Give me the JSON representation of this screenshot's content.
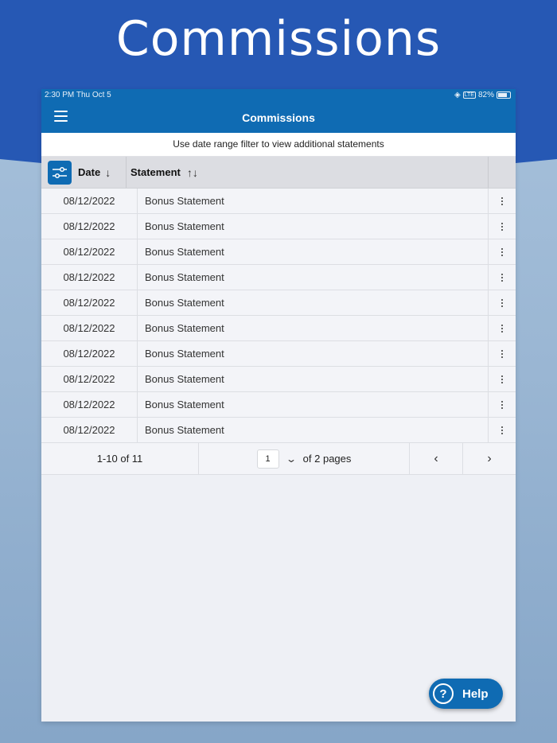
{
  "hero": {
    "title": "Commissions"
  },
  "status_bar": {
    "time": "2:30 PM  Thu Oct 5",
    "network": "LTE",
    "battery": "82%"
  },
  "header": {
    "title": "Commissions"
  },
  "notice": "Use date range filter to view additional statements",
  "grid": {
    "columns": {
      "date": "Date",
      "statement": "Statement"
    },
    "sort_icons": {
      "date": "↓",
      "statement": "↑↓"
    },
    "rows": [
      {
        "date": "08/12/2022",
        "statement": "Bonus Statement"
      },
      {
        "date": "08/12/2022",
        "statement": "Bonus Statement"
      },
      {
        "date": "08/12/2022",
        "statement": "Bonus Statement"
      },
      {
        "date": "08/12/2022",
        "statement": "Bonus Statement"
      },
      {
        "date": "08/12/2022",
        "statement": "Bonus Statement"
      },
      {
        "date": "08/12/2022",
        "statement": "Bonus Statement"
      },
      {
        "date": "08/12/2022",
        "statement": "Bonus Statement"
      },
      {
        "date": "08/12/2022",
        "statement": "Bonus Statement"
      },
      {
        "date": "08/12/2022",
        "statement": "Bonus Statement"
      },
      {
        "date": "08/12/2022",
        "statement": "Bonus Statement"
      }
    ]
  },
  "pager": {
    "count": "1-10 of 11",
    "page": "1",
    "pages_label": "of 2 pages",
    "prev_icon": "‹",
    "next_icon": "›"
  },
  "help": {
    "label": "Help",
    "icon": "?"
  },
  "colors": {
    "banner": "#2658b4",
    "primary": "#0f6bb3"
  }
}
